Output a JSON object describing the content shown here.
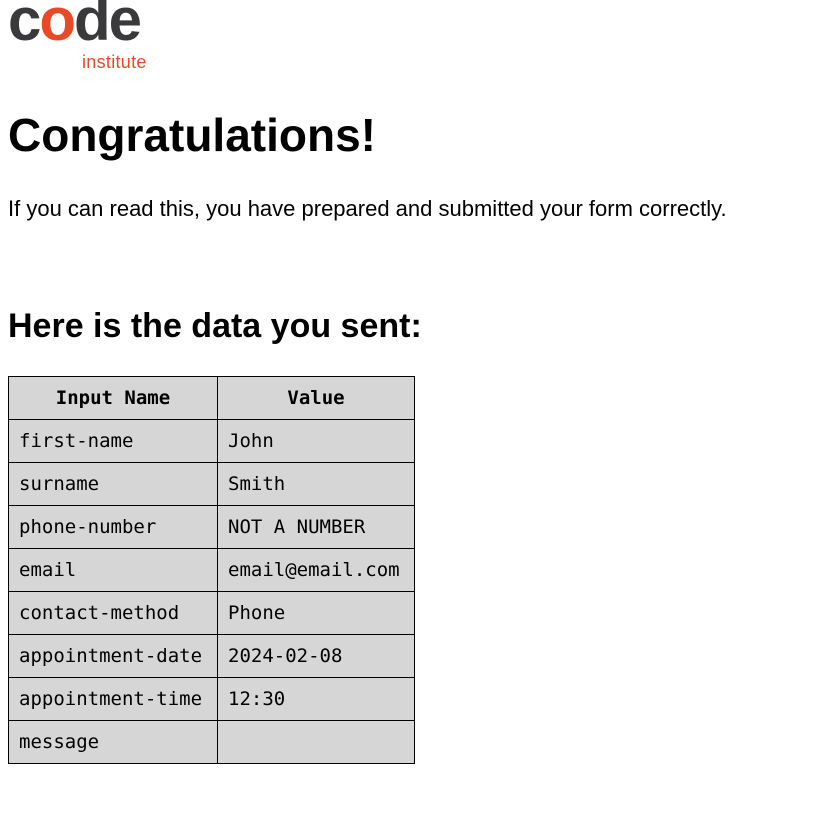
{
  "logo": {
    "word_start": "c",
    "word_accent": "o",
    "word_end": "de",
    "subtitle": "institute",
    "colors": {
      "dark": "#3a3a3c",
      "accent": "#e84a27"
    }
  },
  "heading": "Congratulations!",
  "intro_text": "If you can read this, you have prepared and submitted your form correctly.",
  "subheading": "Here is the data you sent:",
  "table": {
    "headers": [
      "Input Name",
      "Value"
    ],
    "rows": [
      [
        "first-name",
        "John"
      ],
      [
        "surname",
        "Smith"
      ],
      [
        "phone-number",
        "NOT A NUMBER"
      ],
      [
        "email",
        "email@email.com"
      ],
      [
        "contact-method",
        "Phone"
      ],
      [
        "appointment-date",
        "2024-02-08"
      ],
      [
        "appointment-time",
        "12:30"
      ],
      [
        "message",
        ""
      ]
    ],
    "cell_background": "#d6d6d6"
  }
}
